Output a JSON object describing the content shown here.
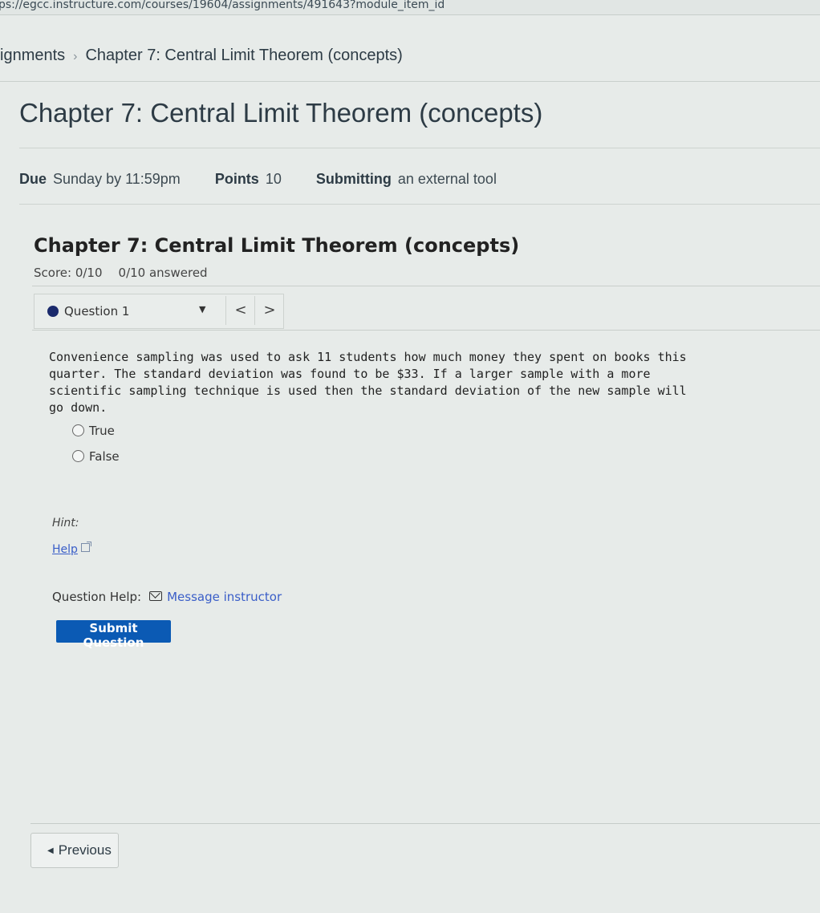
{
  "browser": {
    "url": "ps://egcc.instructure.com/courses/19604/assignments/491643?module_item_id"
  },
  "breadcrumbs": {
    "parent": "ignments",
    "separator": "›",
    "current": "Chapter 7: Central Limit Theorem (concepts)"
  },
  "assignment": {
    "title": "Chapter 7: Central Limit Theorem (concepts)",
    "due_label": "Due",
    "due_value": "Sunday by 11:59pm",
    "points_label": "Points",
    "points_value": "10",
    "submitting_label": "Submitting",
    "submitting_value": "an external tool"
  },
  "quiz": {
    "title": "Chapter 7: Central Limit Theorem (concepts)",
    "score": "Score: 0/10",
    "answered": "0/10 answered",
    "question_selector": "Question 1",
    "prev_glyph": "<",
    "next_glyph": ">",
    "question_text": "Convenience sampling was used to ask 11 students how much money they spent on books this quarter. The standard deviation was found to be $33. If a larger sample with a more scientific sampling technique is used then the standard deviation of the new sample will go down.",
    "options": [
      "True",
      "False"
    ],
    "hint_label": "Hint:",
    "help_link": "Help",
    "question_help_label": "Question Help:",
    "message_link": "Message instructor",
    "submit_label": "Submit Question"
  },
  "footer": {
    "previous_label": "Previous"
  }
}
